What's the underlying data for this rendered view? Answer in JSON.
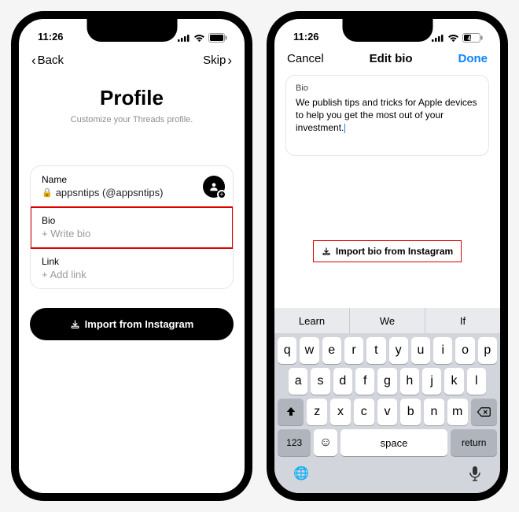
{
  "status": {
    "time": "11:26",
    "battery": "42"
  },
  "left": {
    "back": "Back",
    "skip": "Skip",
    "title": "Profile",
    "subtitle": "Customize your Threads profile.",
    "name_label": "Name",
    "name_value": "appsntips (@appsntips)",
    "bio_label": "Bio",
    "bio_placeholder": "+ Write bio",
    "link_label": "Link",
    "link_placeholder": "+ Add link",
    "import_btn": "Import from Instagram"
  },
  "right": {
    "cancel": "Cancel",
    "title": "Edit bio",
    "done": "Done",
    "bio_label": "Bio",
    "bio_text": "We publish tips and tricks for Apple devices to help you get the most out of your investment.",
    "import_inline": "Import bio from Instagram",
    "suggestions": [
      "Learn",
      "We",
      "If"
    ],
    "rows": {
      "r1": [
        "q",
        "w",
        "e",
        "r",
        "t",
        "y",
        "u",
        "i",
        "o",
        "p"
      ],
      "r2": [
        "a",
        "s",
        "d",
        "f",
        "g",
        "h",
        "j",
        "k",
        "l"
      ],
      "r3": [
        "z",
        "x",
        "c",
        "v",
        "b",
        "n",
        "m"
      ]
    },
    "num_key": "123",
    "space": "space",
    "return": "return"
  }
}
